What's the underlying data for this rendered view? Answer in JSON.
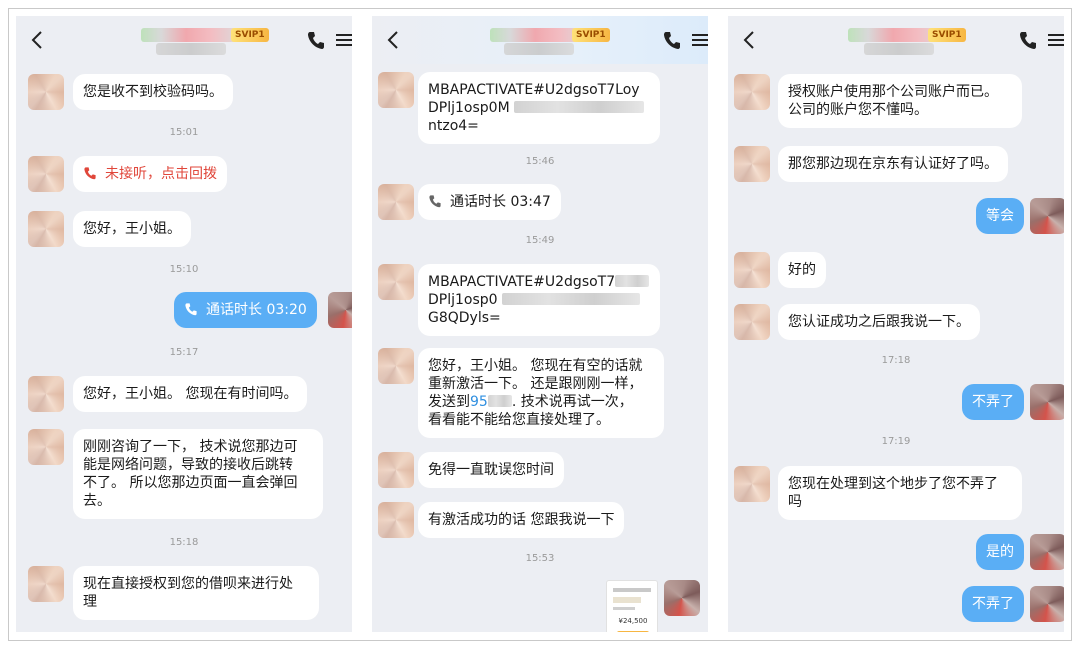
{
  "panels": [
    {
      "header": {
        "vip": "SVIP1"
      },
      "messages": [
        {
          "from": "them",
          "text": "您是收不到校验码吗。"
        },
        {
          "time": "15:01"
        },
        {
          "from": "them",
          "kind": "missed-call",
          "text": "未接听，点击回拨"
        },
        {
          "from": "them",
          "text": "您好，王小姐。"
        },
        {
          "time": "15:10"
        },
        {
          "from": "me",
          "kind": "call",
          "text": "通话时长 03:20"
        },
        {
          "time": "15:17"
        },
        {
          "from": "them",
          "text": "您好，王小姐。 您现在有时间吗。"
        },
        {
          "from": "them",
          "lines": [
            "刚刚咨询了一下， 技术说您那边可",
            "能是网络问题，导致的接收后跳转",
            "不了。 所以您那边页面一直会弹回",
            "去。"
          ]
        },
        {
          "time": "15:18"
        },
        {
          "from": "them",
          "lines": [
            "现在直接授权到您的借呗来进行处",
            "理"
          ]
        }
      ]
    },
    {
      "header": {
        "vip": "SVIP1"
      },
      "messages": [
        {
          "from": "them",
          "lines": [
            "MBAPACTIVATE#U2dgsoT7Loy",
            "DPlj1osp0M",
            "ntzo4="
          ]
        },
        {
          "time": "15:46"
        },
        {
          "from": "them",
          "kind": "call",
          "text": "通话时长 03:47"
        },
        {
          "time": "15:49"
        },
        {
          "from": "them",
          "lines": [
            "MBAPACTIVATE#U2dgsoT7",
            "DPlj1osp0",
            "G8QDyls="
          ]
        },
        {
          "from": "them",
          "lines": [
            "您好，王小姐。 您现在有空的话就",
            "重新激活一下。 还是跟刚刚一样，",
            "发送到",
            "95",
            ". 技术说再试一次，",
            "看看能不能给您直接处理了。"
          ]
        },
        {
          "from": "them",
          "text": "免得一直耽误您时间"
        },
        {
          "from": "them",
          "text": "有激活成功的话 您跟我说一下"
        },
        {
          "time": "15:53"
        },
        {
          "from": "me",
          "kind": "image",
          "amount": "¥24,500"
        }
      ]
    },
    {
      "header": {
        "vip": "SVIP1"
      },
      "messages": [
        {
          "from": "them",
          "lines": [
            "授权账户使用那个公司账户而已。",
            "公司的账户您不懂吗。"
          ]
        },
        {
          "from": "them",
          "text": "那您那边现在京东有认证好了吗。"
        },
        {
          "from": "me",
          "text": "等会"
        },
        {
          "from": "them",
          "text": "好的"
        },
        {
          "from": "them",
          "text": "您认证成功之后跟我说一下。"
        },
        {
          "time": "17:18"
        },
        {
          "from": "me",
          "text": "不弄了"
        },
        {
          "time": "17:19"
        },
        {
          "from": "them",
          "lines": [
            "您现在处理到这个地步了您不弄了",
            "吗"
          ]
        },
        {
          "from": "me",
          "text": "是的"
        },
        {
          "from": "me",
          "text": "不弄了"
        }
      ]
    }
  ]
}
